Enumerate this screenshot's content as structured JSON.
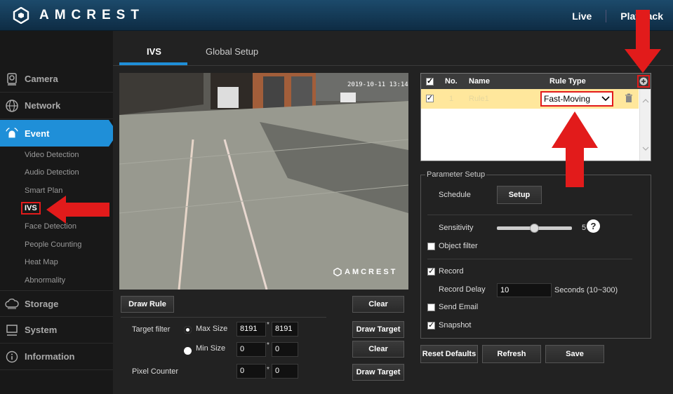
{
  "header": {
    "brand": "AMCREST",
    "nav": [
      "Live",
      "Playback"
    ]
  },
  "sidebar": {
    "items": [
      {
        "label": "Camera",
        "icon": "camera-icon"
      },
      {
        "label": "Network",
        "icon": "network-globe-icon"
      },
      {
        "label": "Event",
        "icon": "alarm-icon"
      },
      {
        "label": "Storage",
        "icon": "cloud-storage-icon"
      },
      {
        "label": "System",
        "icon": "monitor-icon"
      },
      {
        "label": "Information",
        "icon": "info-icon"
      }
    ],
    "event_sub": [
      "Video Detection",
      "Audio Detection",
      "Smart Plan",
      "IVS",
      "Face Detection",
      "People Counting",
      "Heat Map",
      "Abnormality"
    ]
  },
  "tabs": [
    "IVS",
    "Global Setup"
  ],
  "video": {
    "timestamp": "2019-10-11 13:14",
    "watermark": "AMCREST"
  },
  "controls": {
    "draw_rule": "Draw Rule",
    "clear": "Clear",
    "draw_target": "Draw Target",
    "target_filter": "Target filter",
    "max_size": "Max Size",
    "min_size": "Min Size",
    "pixel_counter": "Pixel Counter",
    "max_w": "8191",
    "max_h": "8191",
    "min_w": "0",
    "min_h": "0",
    "pix_w": "0",
    "pix_h": "0",
    "star": "*"
  },
  "rule_table": {
    "columns": [
      "No.",
      "Name",
      "Rule Type"
    ],
    "rows": [
      {
        "no": "1",
        "name": "Rule1",
        "type": "Fast-Moving",
        "checked": true
      }
    ]
  },
  "parameter_setup": {
    "legend": "Parameter Setup",
    "schedule": "Schedule",
    "setup": "Setup",
    "sensitivity": "Sensitivity",
    "sensitivity_value": "5",
    "sensitivity_level": 0.5,
    "object_filter": "Object filter",
    "record": "Record",
    "record_delay": "Record Delay",
    "record_delay_value": "10",
    "seconds": "Seconds (10~300)",
    "send_email": "Send Email",
    "snapshot": "Snapshot",
    "help": "?"
  },
  "footer_buttons": [
    "Reset Defaults",
    "Refresh",
    "Save"
  ],
  "colors": {
    "accent": "#1f8fd8",
    "arrow": "#e21b1b",
    "highlight_row": "#ffe79c"
  }
}
